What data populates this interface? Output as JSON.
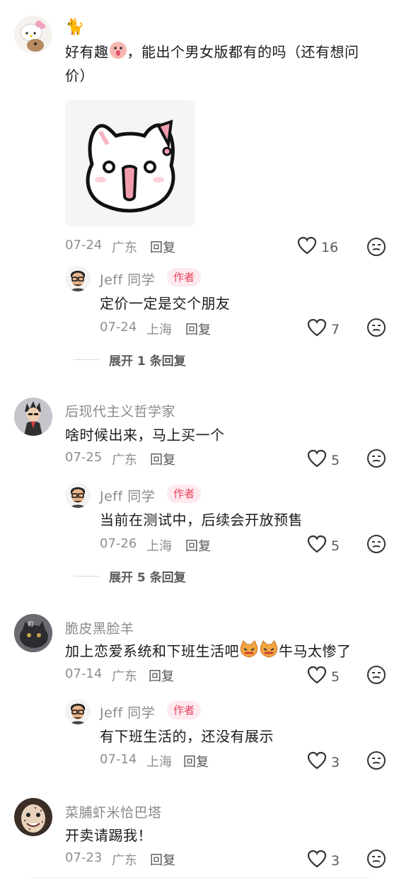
{
  "comments": [
    {
      "user": "🐈",
      "text_before": "好有趣",
      "text_after": "，能出个男女版都有的吗（还有想问价）",
      "date": "07-24",
      "location": "广东",
      "reply_label": "回复",
      "likes": "16",
      "reply": {
        "user": "Jeff 同学",
        "badge": "作者",
        "text": "定价一定是交个朋友",
        "date": "07-24",
        "location": "上海",
        "reply_label": "回复",
        "likes": "7"
      },
      "expand": "展开 1 条回复"
    },
    {
      "user": "后现代主义哲学家",
      "text": "啥时候出来，马上买一个",
      "date": "07-25",
      "location": "广东",
      "reply_label": "回复",
      "likes": "5",
      "reply": {
        "user": "Jeff 同学",
        "badge": "作者",
        "text": "当前在测试中，后续会开放预售",
        "date": "07-26",
        "location": "上海",
        "reply_label": "回复",
        "likes": "5"
      },
      "expand": "展开 5 条回复"
    },
    {
      "user": "脆皮黑脸羊",
      "text_before": "加上恋爱系统和下班生活吧",
      "text_after": "牛马太惨了",
      "date": "07-14",
      "location": "广东",
      "reply_label": "回复",
      "likes": "5",
      "reply": {
        "user": "Jeff 同学",
        "badge": "作者",
        "text": "有下班生活的，还没有展示",
        "date": "07-14",
        "location": "上海",
        "reply_label": "回复",
        "likes": "3"
      }
    },
    {
      "user": "菜脯虾米恰巴塔",
      "text": "开卖请踢我！",
      "date": "07-23",
      "location": "广东",
      "reply_label": "回复",
      "likes": "3"
    }
  ],
  "colors": {
    "accent": "#e8425d",
    "badge_bg": "#fde9ee",
    "meta": "#8e8e93"
  },
  "icons": [
    "heart-icon",
    "unlike-face-icon",
    "cat-emoji-icon",
    "surprised-emoji-icon"
  ]
}
